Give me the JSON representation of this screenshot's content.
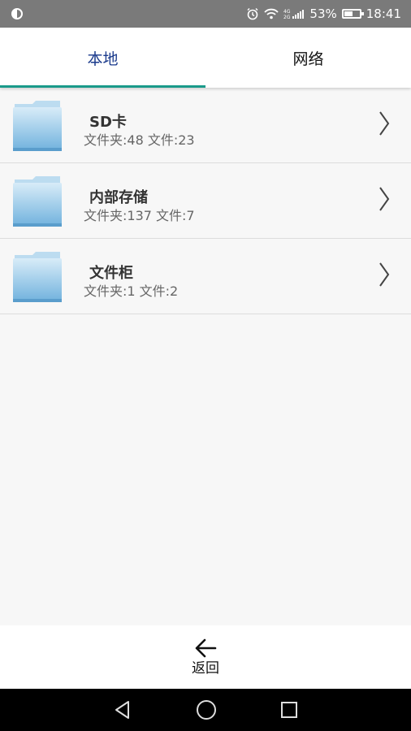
{
  "status_bar": {
    "battery_percent": "53%",
    "time": "18:41",
    "battery_level": 0.53,
    "network": "4G 2G"
  },
  "tabs": [
    {
      "label": "本地",
      "active": true
    },
    {
      "label": "网络",
      "active": false
    }
  ],
  "colors": {
    "active_tab_text": "#1a3a8c",
    "tab_indicator": "#1a9a8a",
    "folder_blue": "#8cc4e8"
  },
  "storage_list": [
    {
      "title": "SD卡",
      "subtitle": "文件夹:48 文件:23"
    },
    {
      "title": "内部存储",
      "subtitle": "文件夹:137 文件:7"
    },
    {
      "title": "文件柜",
      "subtitle": "文件夹:1 文件:2"
    }
  ],
  "back": {
    "label": "返回",
    "icon": "arrow-left-icon"
  },
  "nav": {
    "icons": [
      "back-triangle-icon",
      "home-circle-icon",
      "recents-square-icon"
    ]
  }
}
